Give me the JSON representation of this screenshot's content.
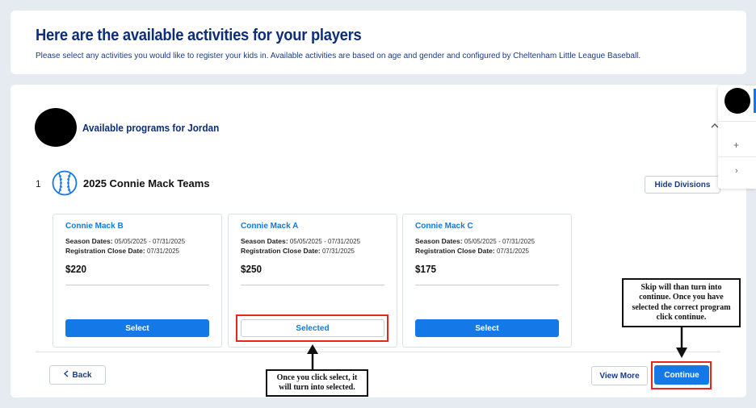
{
  "header": {
    "title": "Here are the available activities for your players",
    "subtitle": "Please select any activities you would like to register your kids in. Available activities are based on age and gender and configured by Cheltenham Little League Baseball."
  },
  "player_section": {
    "title": "Available programs for Jordan",
    "collapse_icon": "chevron-up-icon"
  },
  "program": {
    "index": "1",
    "icon": "baseball-icon",
    "name": "2025 Connie Mack Teams",
    "hide_divisions_label": "Hide Divisions"
  },
  "divisions": [
    {
      "name": "Connie Mack B",
      "season_label": "Season Dates:",
      "season_dates": "05/05/2025 - 07/31/2025",
      "reg_label": "Registration Close Date:",
      "reg_close": "07/31/2025",
      "price": "$220",
      "button_label": "Select"
    },
    {
      "name": "Connie Mack A",
      "season_label": "Season Dates:",
      "season_dates": "05/05/2025 - 07/31/2025",
      "reg_label": "Registration Close Date:",
      "reg_close": "07/31/2025",
      "price": "$250",
      "button_label": "Selected"
    },
    {
      "name": "Connie Mack C",
      "season_label": "Season Dates:",
      "season_dates": "05/05/2025 - 07/31/2025",
      "reg_label": "Registration Close Date:",
      "reg_close": "07/31/2025",
      "price": "$175",
      "button_label": "Select"
    }
  ],
  "footer": {
    "back_label": "Back",
    "view_more_label": "View More",
    "continue_label": "Continue"
  },
  "side_panel": {
    "plus_icon": "+",
    "chevron_icon": "›"
  },
  "annotations": {
    "selected_note": "Once you click select, it will turn into selected.",
    "continue_note": "Skip will than turn into continue. Once you have selected the correct program click continue.",
    "highlight_color": "#e8271c"
  }
}
